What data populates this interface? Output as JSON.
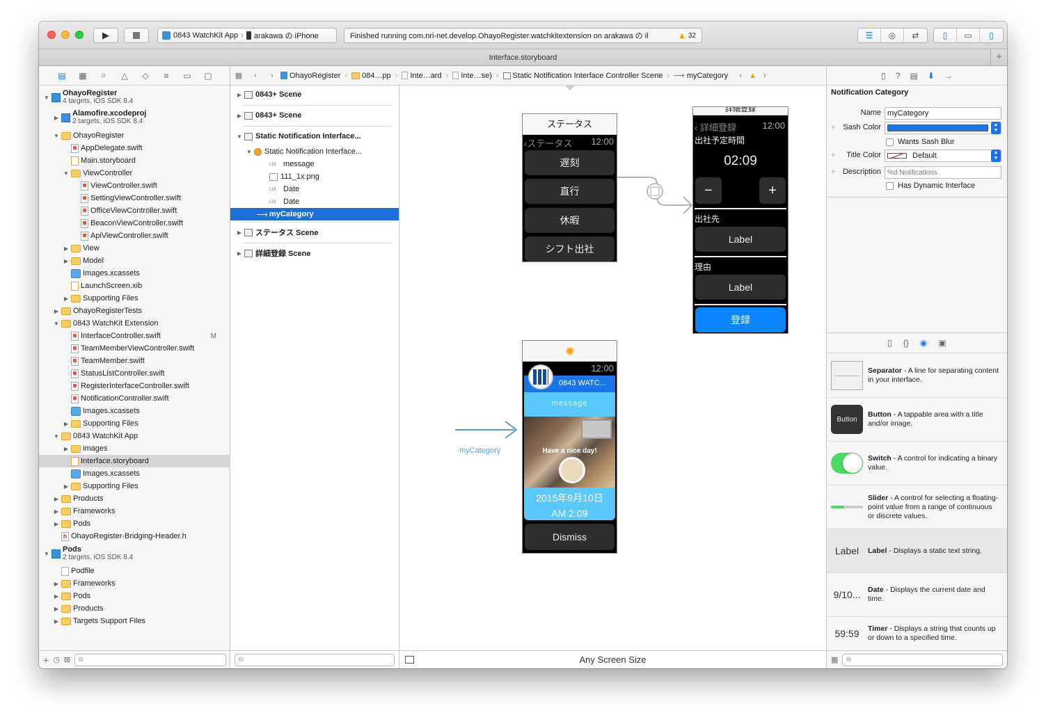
{
  "toolbar": {
    "scheme_target": "0843 WatchKit App",
    "scheme_device": "arakawa の iPhone",
    "activity_text": "Finished running com.nri-net.develop.OhayoRegister.watchkitextension on arakawa の il",
    "warning_count": "32"
  },
  "tab": {
    "title": "Interface.storyboard"
  },
  "navigator": {
    "project": {
      "name": "OhayoRegister",
      "subtitle": "4 targets, iOS SDK 8.4"
    },
    "alamofire": {
      "name": "Alamofire.xcodeproj",
      "subtitle": "2 targets, iOS SDK 8.4"
    },
    "items": [
      "OhayoRegister",
      "AppDelegate.swift",
      "Main.storyboard",
      "ViewController",
      "ViewController.swift",
      "SettingViewController.swift",
      "OfficeViewController.swift",
      "BeaconViewController.swift",
      "ApiViewController.swift",
      "View",
      "Model",
      "Images.xcassets",
      "LaunchScreen.xib",
      "Supporting Files",
      "OhayoRegisterTests",
      "0843 WatchKit Extension",
      "InterfaceController.swift",
      "TeamMemberViewController.swift",
      "TeamMember.swift",
      "StatusListController.swift",
      "RegisterInterfaceController.swift",
      "NotificationController.swift",
      "Images.xcassets",
      "Supporting Files",
      "0843 WatchKit App",
      "images",
      "Interface.storyboard",
      "Images.xcassets",
      "Supporting Files",
      "Products",
      "Frameworks",
      "Pods",
      "OhayoRegister-Bridging-Header.h"
    ],
    "modified_mark": "M",
    "pods_project": {
      "name": "Pods",
      "subtitle": "2 targets, iOS SDK 8.4"
    },
    "pods_items": [
      "Podfile",
      "Frameworks",
      "Pods",
      "Products",
      "Targets Support Files"
    ]
  },
  "jumpbar": {
    "crumbs": [
      "OhayoRegister",
      "084…pp",
      "Inte…ard",
      "Inte…se)",
      "Static Notification Interface Controller Scene",
      "myCategory"
    ]
  },
  "outline": {
    "scene1": "0843+ Scene",
    "scene2": "0843+ Scene",
    "scene3": "Static Notification Interface...",
    "controller": "Static Notification Interface...",
    "lbl_tag": "Lbl",
    "message": "message",
    "image": "111_1x.png",
    "date1": "Date",
    "date2": "Date",
    "category": "myCategory",
    "scene4": "ステータス Scene",
    "scene5": "詳細登録 Scene"
  },
  "canvas": {
    "status_screen": {
      "title": "ステータス",
      "back": "‹ステータス",
      "time": "12:00",
      "buttons": [
        "遅刻",
        "直行",
        "休暇",
        "シフト出社"
      ]
    },
    "detail_screen": {
      "title": "詳細登録",
      "back": "‹ 詳細登録",
      "time": "12:00",
      "planned_label": "出社予定時間",
      "planned_time": "02:09",
      "minus": "−",
      "plus": "+",
      "dest_label": "出社先",
      "dest_button": "Label",
      "reason_label": "理由",
      "reason_button": "Label",
      "register_button": "登録"
    },
    "notification_screen": {
      "time": "12:00",
      "app_name": "0843 WATC...",
      "message": "message",
      "photo_text": "Have a nice day!",
      "date": "2015年9月10日",
      "time_line": "AM 2:09",
      "dismiss": "Dismiss"
    },
    "entry_label": "myCategory",
    "bottom_label": "Any Screen Size"
  },
  "inspector": {
    "section": "Notification Category",
    "name_label": "Name",
    "name_value": "myCategory",
    "sash_label": "Sash Color",
    "sash_color": "#1a74e8",
    "wants_blur": "Wants Sash Blur",
    "title_color_label": "Title Color",
    "title_color_value": "Default",
    "description_label": "Description",
    "description_placeholder": "%d Notifications",
    "dynamic": "Has Dynamic Interface"
  },
  "library": [
    {
      "title": "Separator",
      "desc": " - A line for separating content in your interface.",
      "thumb": ""
    },
    {
      "title": "Button",
      "desc": " - A tappable area with a title and/or image.",
      "thumb": "Button"
    },
    {
      "title": "Switch",
      "desc": " - A control for indicating a binary value.",
      "thumb": ""
    },
    {
      "title": "Slider",
      "desc": " - A control for selecting a floating-point value from a range of continuous or discrete values.",
      "thumb": ""
    },
    {
      "title": "Label",
      "desc": " - Displays a static text string.",
      "thumb": "Label"
    },
    {
      "title": "Date",
      "desc": " - Displays the current date and time.",
      "thumb": "9/10..."
    },
    {
      "title": "Timer",
      "desc": " - Displays a string that counts up or down to a specified time.",
      "thumb": "59:59"
    }
  ],
  "colors": {
    "accent": "#1a74e8",
    "watch_blue": "#5ac8fa",
    "register_blue": "#0a84ff"
  }
}
